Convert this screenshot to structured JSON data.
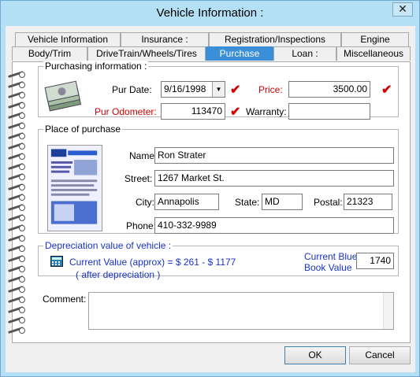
{
  "window": {
    "title": "Vehicle Information :",
    "close_glyph": "✕"
  },
  "tabs_row1": [
    "Vehicle Information",
    "Insurance :",
    "Registration/Inspections",
    "Engine"
  ],
  "tabs_row2": [
    "Body/Trim",
    "DriveTrain/Wheels/Tires",
    "Purchase",
    "Loan :",
    "Miscellaneous"
  ],
  "active_tab": "Purchase",
  "purchasing": {
    "legend": "Purchasing information :",
    "pur_date_label": "Pur Date:",
    "pur_date_value": "9/16/1998",
    "price_label": "Price:",
    "price_value": "3500.00",
    "odometer_label": "Pur Odometer:",
    "odometer_value": "113470",
    "warranty_label": "Warranty:",
    "warranty_value": ""
  },
  "place": {
    "legend": "Place of purchase",
    "name_label": "Name:",
    "name_value": "Ron Strater",
    "street_label": "Street:",
    "street_value": "1267 Market St.",
    "city_label": "City:",
    "city_value": "Annapolis",
    "state_label": "State:",
    "state_value": "MD",
    "postal_label": "Postal:",
    "postal_value": "21323",
    "phone_label": "Phone:",
    "phone_value": "410-332-9989"
  },
  "depreciation": {
    "legend": "Depreciation value of vehicle :",
    "current_value_text": "Current Value (approx) = $ 261 - $ 1177",
    "after_text": "( after depreciation )",
    "blue_book_label_line1": "Current Blue",
    "blue_book_label_line2": "Book Value",
    "blue_book_value": "1740"
  },
  "comment": {
    "label": "Comment:",
    "value": ""
  },
  "buttons": {
    "ok": "OK",
    "cancel": "Cancel"
  },
  "icons": {
    "check": "✔",
    "dropdown": "▼",
    "calculator": "calculator-icon"
  },
  "colors": {
    "active_tab": "#3b8fd8",
    "required_label": "#d40000",
    "info_text": "#1832c8",
    "frame": "#b4e0f6"
  }
}
